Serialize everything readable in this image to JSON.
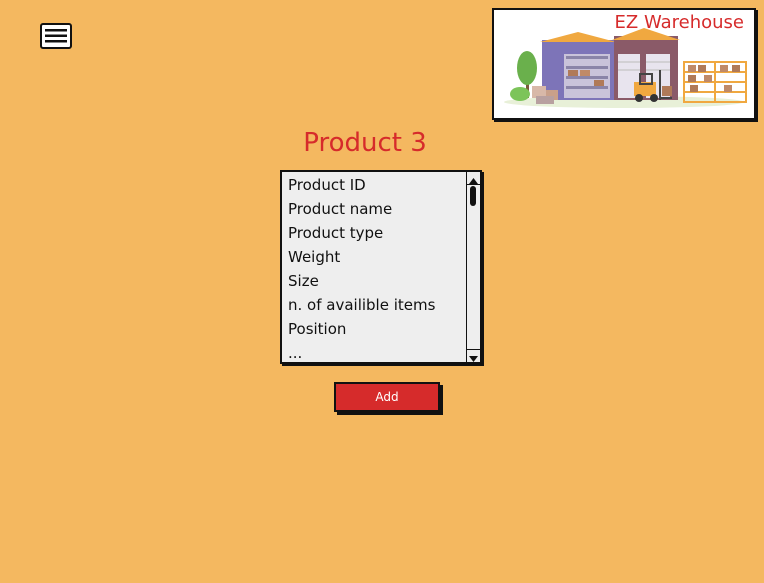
{
  "header": {
    "menu_icon": "hamburger-menu-icon",
    "logo_title": "EZ Warehouse"
  },
  "main": {
    "title": "Product 3",
    "fields": [
      "Product ID",
      "Product name",
      "Product type",
      "Weight",
      "Size",
      "n. of availible items",
      "Position",
      "..."
    ],
    "add_label": "Add"
  },
  "colors": {
    "background": "#f4b860",
    "accent": "#d62b2b",
    "listbox_bg": "#eeeeee"
  }
}
